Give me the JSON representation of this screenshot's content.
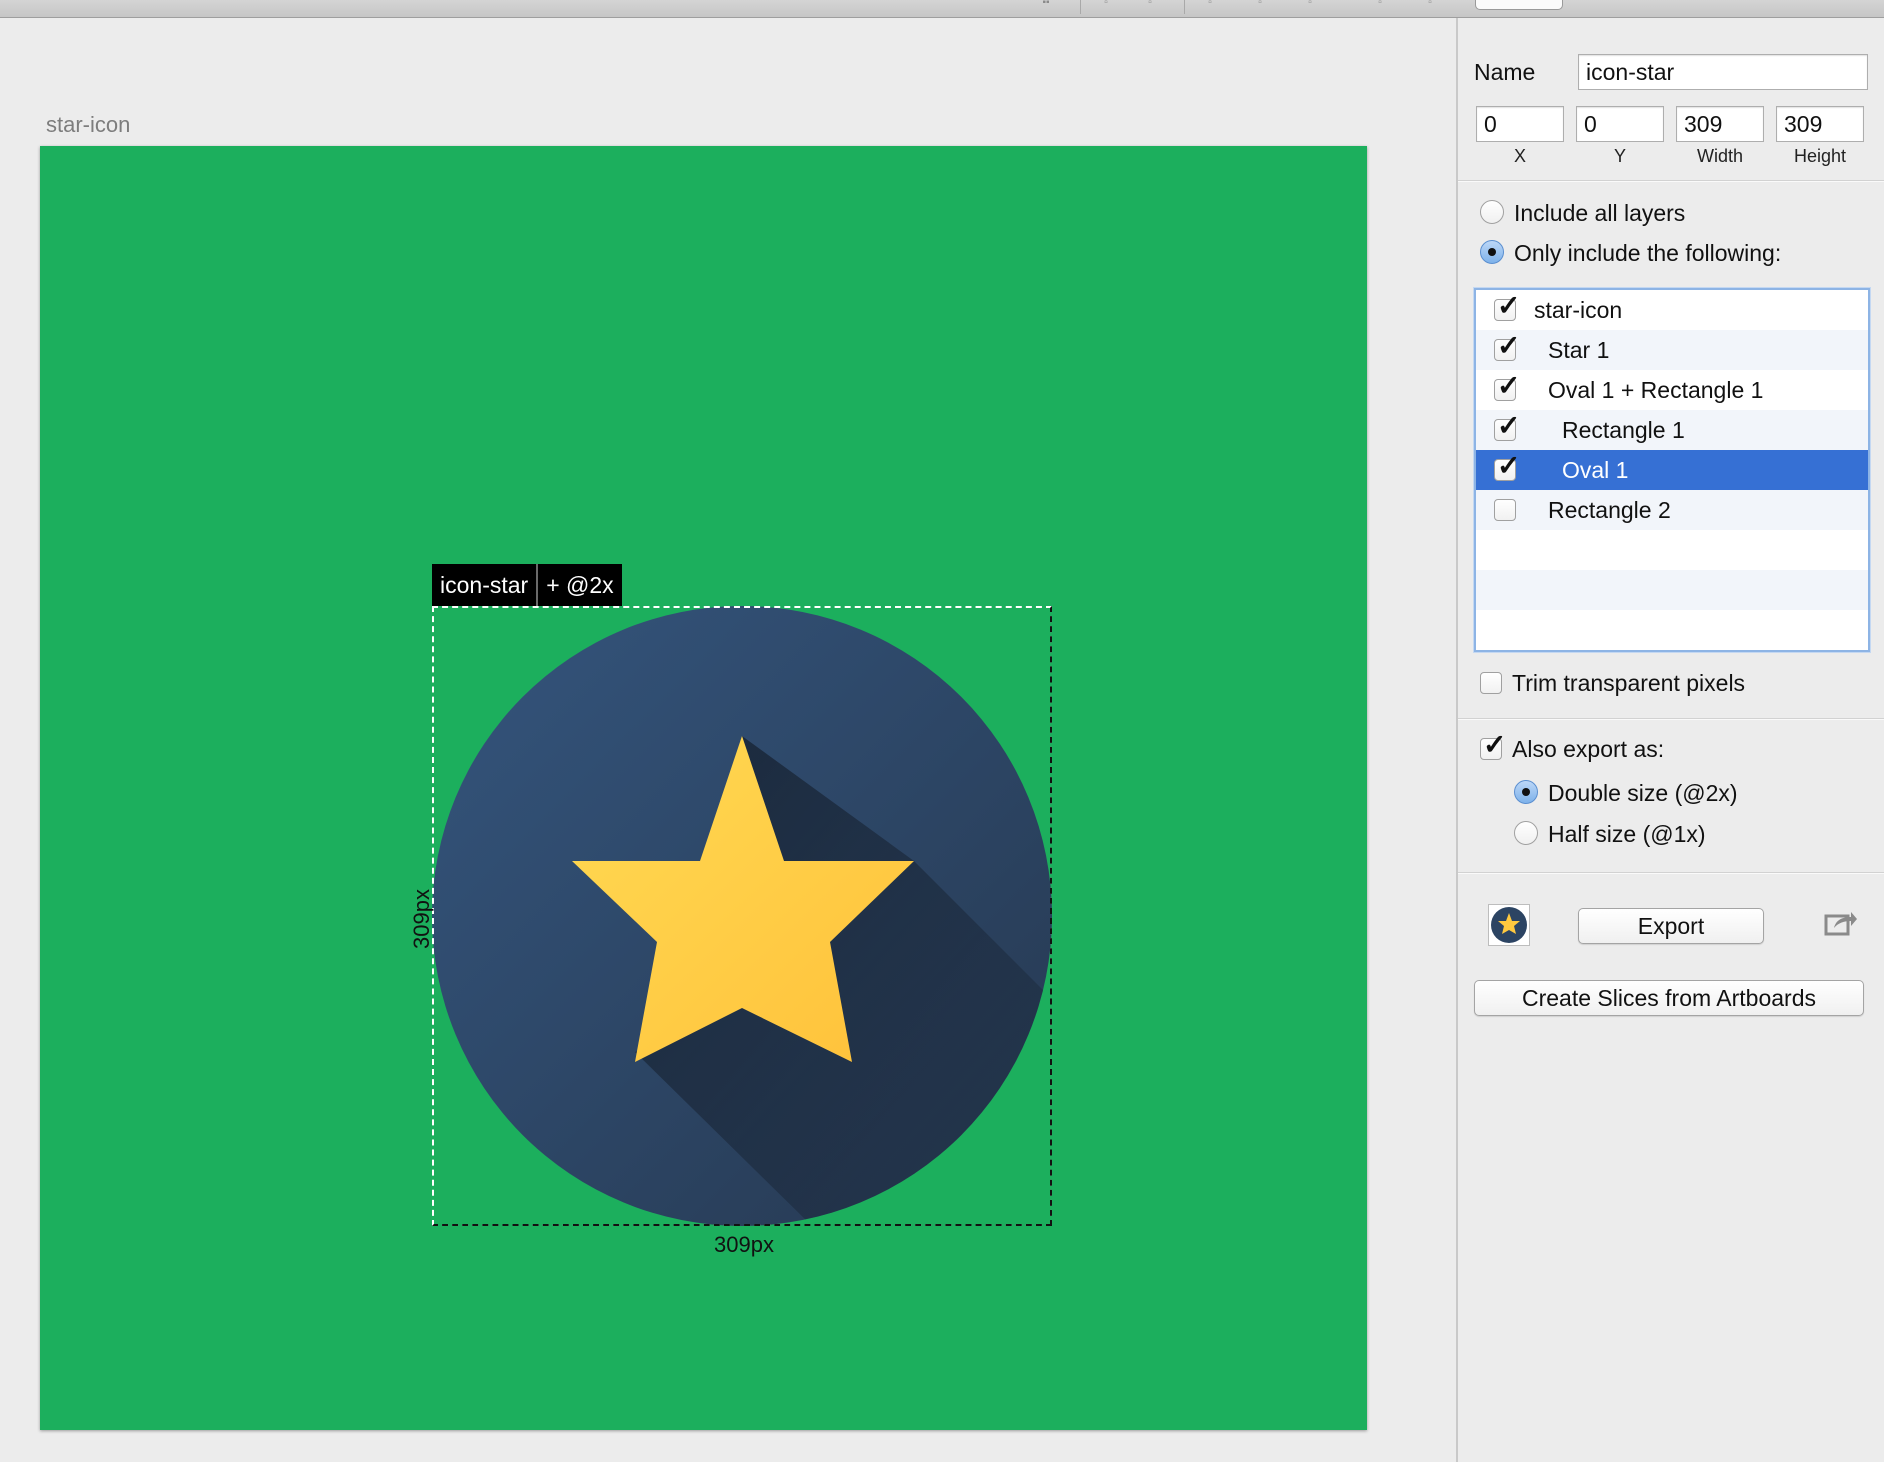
{
  "artboard": {
    "label": "star-icon",
    "background": "#1caf5d"
  },
  "slice": {
    "name": "icon-star",
    "export_tag": "+ @2x",
    "width_label": "309px",
    "height_label": "309px"
  },
  "icon": {
    "circle_color": "#2c4463",
    "star_color": "#ffc93f"
  },
  "inspector": {
    "name_label": "Name",
    "name_value": "icon-star",
    "x_value": "0",
    "y_value": "0",
    "width_value": "309",
    "height_value": "309",
    "x_caption": "X",
    "y_caption": "Y",
    "width_caption": "Width",
    "height_caption": "Height",
    "include_all_label": "Include all layers",
    "only_include_label": "Only include the following:",
    "layers": [
      {
        "label": "star-icon",
        "checked": true,
        "selected": false
      },
      {
        "label": "Star 1",
        "checked": true,
        "selected": false
      },
      {
        "label": "Oval 1 + Rectangle 1",
        "checked": true,
        "selected": false
      },
      {
        "label": "Rectangle 1",
        "checked": true,
        "selected": false
      },
      {
        "label": "Oval 1",
        "checked": true,
        "selected": true
      },
      {
        "label": "Rectangle 2",
        "checked": false,
        "selected": false
      }
    ],
    "trim_label": "Trim transparent pixels",
    "also_export_label": "Also export as:",
    "double_size_label": "Double size (@2x)",
    "half_size_label": "Half size (@1x)",
    "export_button": "Export",
    "create_slices_button": "Create Slices from Artboards"
  }
}
